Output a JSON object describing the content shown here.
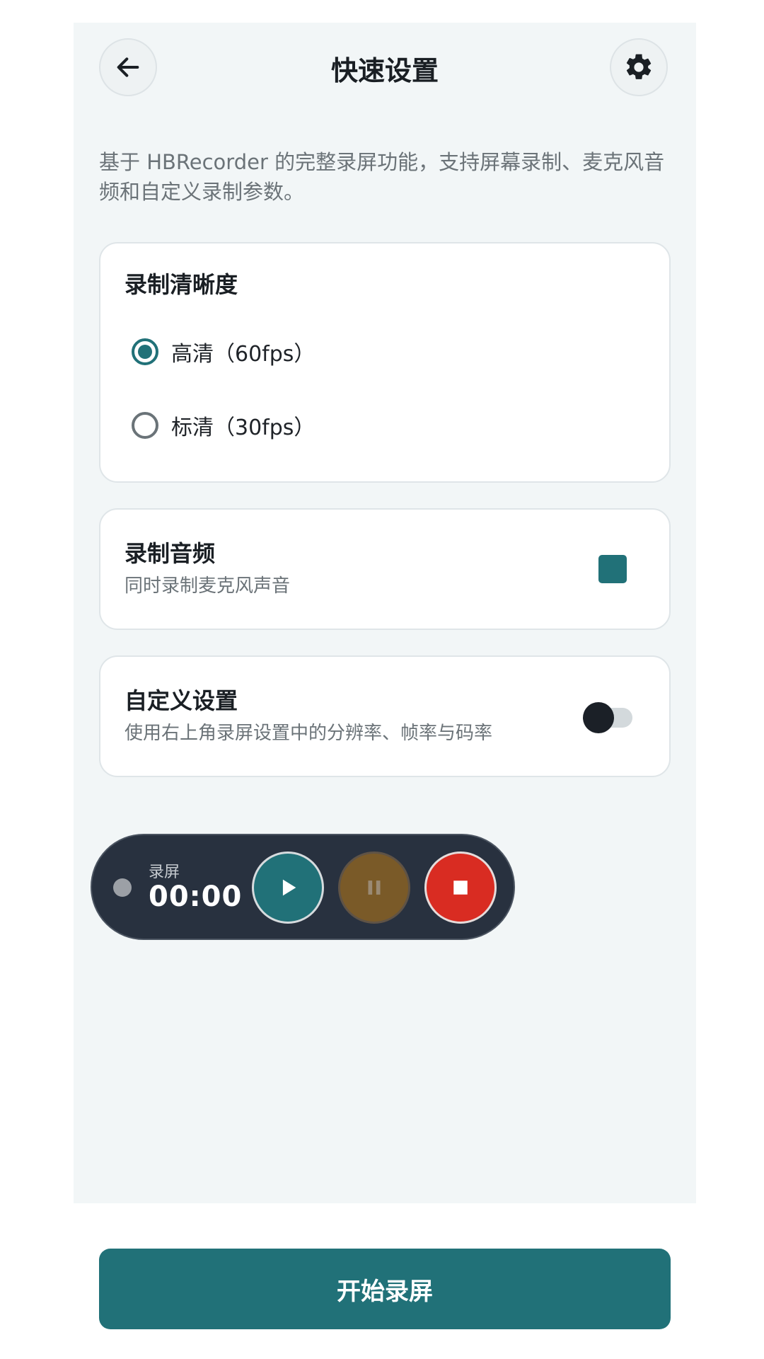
{
  "header": {
    "title": "快速设置",
    "back_icon": "arrow-left-icon",
    "settings_icon": "gear-icon"
  },
  "description": "基于 HBRecorder 的完整录屏功能，支持屏幕录制、麦克风音频和自定义录制参数。",
  "quality": {
    "title": "录制清晰度",
    "options": [
      {
        "label": "高清（60fps）",
        "selected": true
      },
      {
        "label": "标清（30fps）",
        "selected": false
      }
    ]
  },
  "audio": {
    "title": "录制音频",
    "subtitle": "同时录制麦克风声音",
    "checked": true
  },
  "custom": {
    "title": "自定义设置",
    "subtitle": "使用右上角录屏设置中的分辨率、帧率与码率",
    "enabled": false
  },
  "recorder": {
    "label": "录屏",
    "time": "00:00",
    "play_icon": "play-icon",
    "pause_icon": "pause-icon",
    "stop_icon": "stop-icon"
  },
  "start_button": {
    "label": "开始录屏"
  },
  "colors": {
    "accent": "#217178",
    "panel_bg": "#f2f6f7",
    "recorder_bg": "#28313f",
    "pause": "#7a5a28",
    "stop": "#d92c22"
  }
}
